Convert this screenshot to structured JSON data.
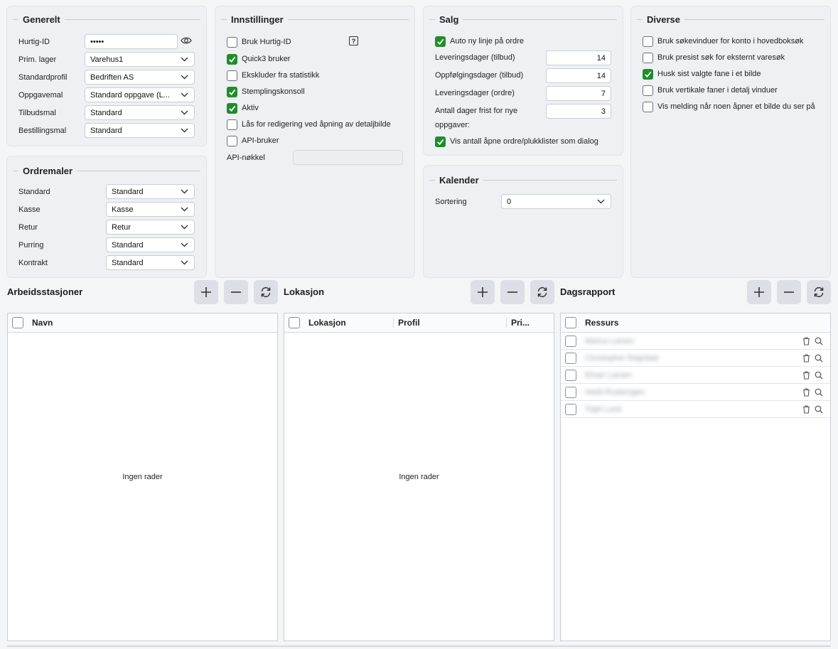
{
  "generelt": {
    "title": "Generelt",
    "fields": [
      {
        "label": "Hurtig-ID",
        "value": "•••••",
        "type": "password"
      },
      {
        "label": "Prim. lager",
        "value": "Varehus1",
        "type": "select"
      },
      {
        "label": "Standardprofil",
        "value": "Bedriften AS",
        "type": "select"
      },
      {
        "label": "Oppgavemal",
        "value": "Standard oppgave (L...",
        "type": "select"
      },
      {
        "label": "Tilbudsmal",
        "value": "Standard",
        "type": "select"
      },
      {
        "label": "Bestillingsmal",
        "value": "Standard",
        "type": "select"
      }
    ]
  },
  "ordremaler": {
    "title": "Ordremaler",
    "fields": [
      {
        "label": "Standard",
        "value": "Standard"
      },
      {
        "label": "Kasse",
        "value": "Kasse"
      },
      {
        "label": "Retur",
        "value": "Retur"
      },
      {
        "label": "Purring",
        "value": "Standard"
      },
      {
        "label": "Kontrakt",
        "value": "Standard"
      }
    ]
  },
  "innstillinger": {
    "title": "Innstillinger",
    "checkboxes": [
      {
        "label": "Bruk Hurtig-ID",
        "checked": false
      },
      {
        "label": "Quick3 bruker",
        "checked": true
      },
      {
        "label": "Ekskluder fra statistikk",
        "checked": false
      },
      {
        "label": "Stemplingskonsoll",
        "checked": true
      },
      {
        "label": "Aktiv",
        "checked": true
      },
      {
        "label": "Lås for redigering ved åpning av detaljbilde",
        "checked": false
      },
      {
        "label": "API-bruker",
        "checked": false
      }
    ],
    "api_key_label": "API-nøkkel",
    "api_key_value": ""
  },
  "salg": {
    "title": "Salg",
    "auto_new_line": {
      "label": "Auto ny linje på ordre",
      "checked": true
    },
    "fields": [
      {
        "label": "Leveringsdager (tilbud)",
        "value": "14"
      },
      {
        "label": "Oppfølgingsdager (tilbud)",
        "value": "14"
      },
      {
        "label": "Leveringsdager (ordre)",
        "value": "7"
      },
      {
        "label": "Antall dager frist for nye",
        "label2": "oppgaver:",
        "value": "3"
      }
    ],
    "show_open": {
      "label": "Vis antall åpne ordre/plukklister som dialog",
      "checked": true
    }
  },
  "kalender": {
    "title": "Kalender",
    "sort_label": "Sortering",
    "sort_value": "0"
  },
  "diverse": {
    "title": "Diverse",
    "checkboxes": [
      {
        "label": "Bruk søkevinduer for konto i hovedboksøk",
        "checked": false
      },
      {
        "label": "Bruk presist søk for eksternt varesøk",
        "checked": false
      },
      {
        "label": "Husk sist valgte fane i et bilde",
        "checked": true
      },
      {
        "label": "Bruk vertikale faner i detalj vinduer",
        "checked": false
      },
      {
        "label": "Vis melding når noen åpner et bilde du ser på",
        "checked": false
      }
    ]
  },
  "arbeidsstasjoner": {
    "title": "Arbeidsstasjoner",
    "columns": [
      "Navn"
    ],
    "empty_text": "Ingen rader"
  },
  "lokasjon": {
    "title": "Lokasjon",
    "columns": [
      "Lokasjon",
      "Profil",
      "Pri..."
    ],
    "empty_text": "Ingen rader"
  },
  "dagsrapport": {
    "title": "Dagsrapport",
    "columns": [
      "Ressurs"
    ],
    "rows": [
      "Marius Larsen",
      "Christopher Ragnbek",
      "Einarr Larsen",
      "Heidi Rustemgen",
      "Tiqel Lund"
    ]
  },
  "icons": {
    "add": "plus-icon",
    "remove": "minus-icon",
    "refresh": "refresh-icon",
    "delete": "trash-icon",
    "search": "search-icon",
    "show_password": "eye-icon",
    "help": "question-icon"
  },
  "colors": {
    "checked": "#1e8e2a",
    "panel": "#eef0f3",
    "button": "#dcdfe5"
  }
}
